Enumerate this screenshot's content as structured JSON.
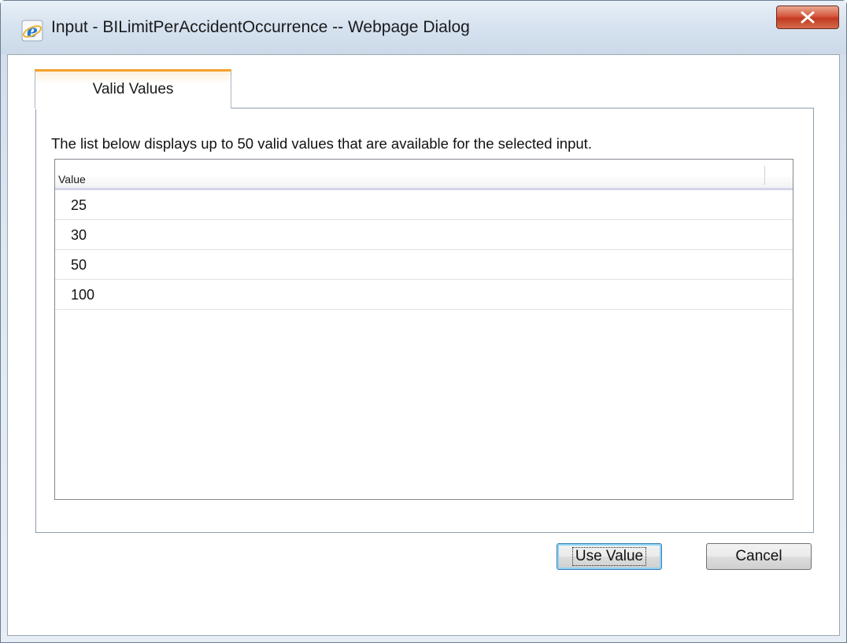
{
  "window": {
    "title": "Input - BILimitPerAccidentOccurrence -- Webpage Dialog",
    "title_icon": "internet-explorer-icon",
    "close_icon": "close-icon"
  },
  "tabs": [
    {
      "label": "Valid Values",
      "selected": true
    }
  ],
  "description": "The list below displays up to 50 valid values that are available for the selected input.",
  "grid": {
    "columns": [
      "Value"
    ],
    "rows": [
      "25",
      "30",
      "50",
      "100"
    ]
  },
  "buttons": {
    "use_value": "Use Value",
    "cancel": "Cancel"
  },
  "colors": {
    "tab_accent": "#f4a12e",
    "close_button": "#c03a22",
    "default_button_focus": "#3c7fb1"
  }
}
